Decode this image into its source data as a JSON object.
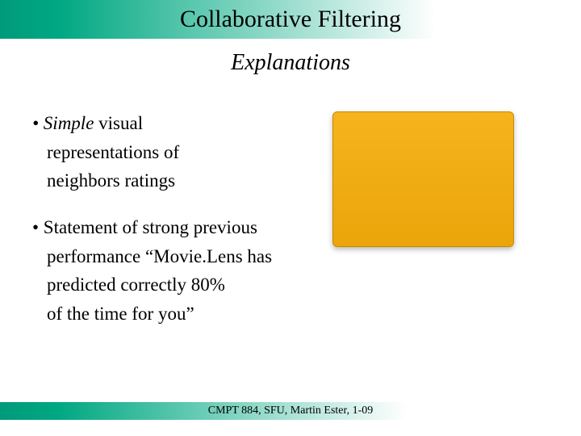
{
  "header": {
    "title": "Collaborative Filtering"
  },
  "subtitle": "Explanations",
  "bullets": [
    {
      "line1_emph": "• Simple",
      "line1_rest": " visual",
      "line2": "representations of",
      "line3": "neighbors ratings"
    },
    {
      "line1": "• Statement of strong previous",
      "line2": "performance “Movie.Lens has",
      "line3": "predicted correctly 80%",
      "line4": "of the time for you”"
    }
  ],
  "footer": {
    "text": "CMPT 884, SFU, Martin Ester, 1-09"
  },
  "colors": {
    "accent": "#009b7a",
    "box_fill": "#f1ab13"
  }
}
